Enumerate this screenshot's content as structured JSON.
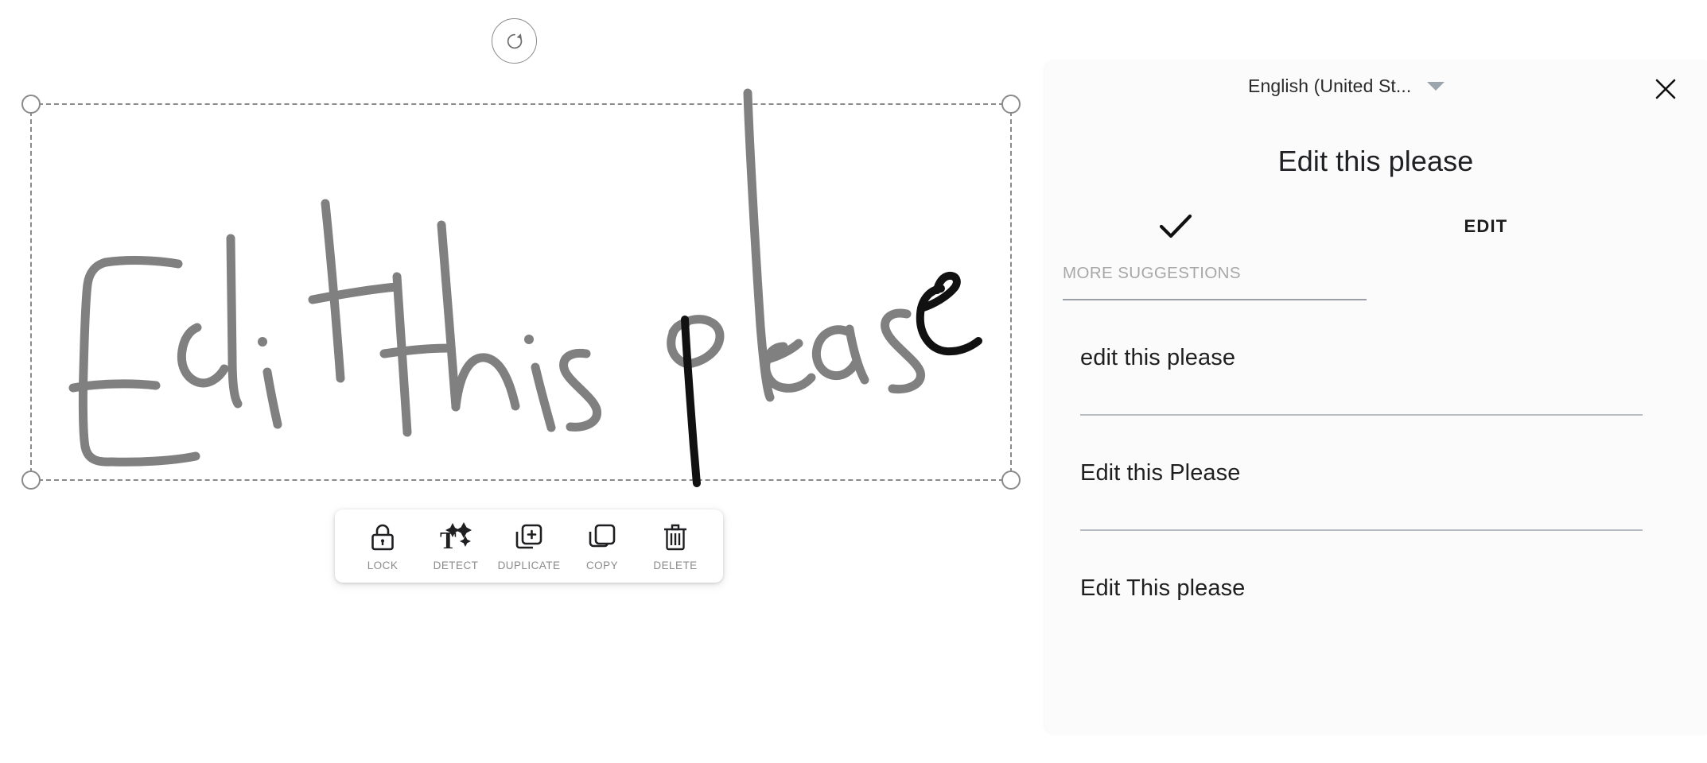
{
  "canvas": {
    "handwriting_text": "Edit this please",
    "selection": {
      "rotate_handle_icon": "rotate-icon",
      "handles": [
        "top-left",
        "top-right",
        "bottom-left",
        "bottom-right"
      ]
    }
  },
  "object_toolbar": {
    "items": [
      {
        "label": "LOCK",
        "icon": "lock-icon"
      },
      {
        "label": "DETECT",
        "icon": "text-detect-sparkle-icon"
      },
      {
        "label": "DUPLICATE",
        "icon": "duplicate-icon"
      },
      {
        "label": "COPY",
        "icon": "copy-icon"
      },
      {
        "label": "DELETE",
        "icon": "trash-icon"
      }
    ]
  },
  "panel": {
    "language": "English (United St...",
    "language_caret_icon": "chevron-down-icon",
    "close_icon": "close-icon",
    "recognized_text": "Edit this please",
    "accept_icon": "checkmark-icon",
    "edit_label": "EDIT",
    "more_suggestions_label": "MORE SUGGESTIONS",
    "suggestions": [
      "edit this please",
      "Edit this Please",
      "Edit This please"
    ]
  },
  "colors": {
    "ink_gray": "#808080",
    "ink_black": "#000000",
    "selection_border": "#8a8a8a",
    "panel_bg": "#fbfbfb",
    "muted_text": "#a7a7a7",
    "divider": "#b6bcc2"
  }
}
